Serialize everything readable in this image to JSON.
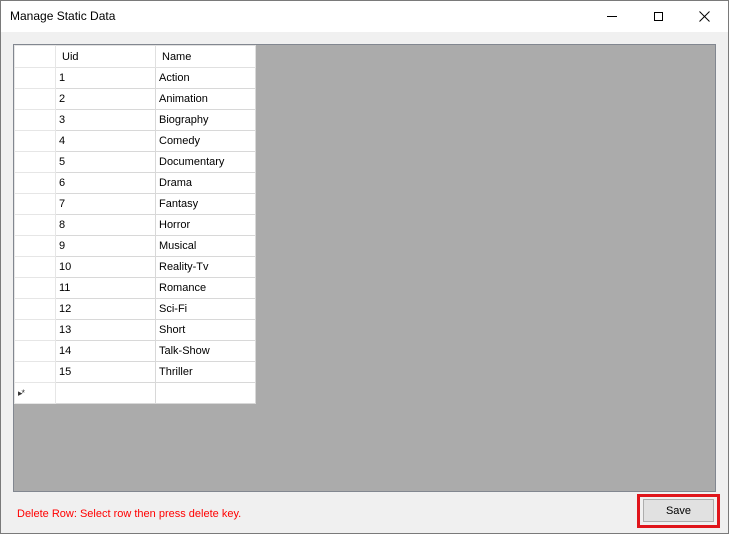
{
  "window": {
    "title": "Manage Static Data",
    "icons": {
      "minimize": "minimize-icon",
      "maximize": "maximize-icon",
      "close": "close-icon"
    }
  },
  "grid": {
    "columns": [
      "Uid",
      "Name"
    ],
    "rows": [
      {
        "uid": "1",
        "name": "Action"
      },
      {
        "uid": "2",
        "name": "Animation"
      },
      {
        "uid": "3",
        "name": "Biography"
      },
      {
        "uid": "4",
        "name": "Comedy"
      },
      {
        "uid": "5",
        "name": "Documentary"
      },
      {
        "uid": "6",
        "name": "Drama"
      },
      {
        "uid": "7",
        "name": "Fantasy"
      },
      {
        "uid": "8",
        "name": "Horror"
      },
      {
        "uid": "9",
        "name": "Musical"
      },
      {
        "uid": "10",
        "name": "Reality-Tv"
      },
      {
        "uid": "11",
        "name": "Romance"
      },
      {
        "uid": "12",
        "name": "Sci-Fi"
      },
      {
        "uid": "13",
        "name": "Short"
      },
      {
        "uid": "14",
        "name": "Talk-Show"
      },
      {
        "uid": "15",
        "name": "Thriller"
      }
    ],
    "new_row_marker": "▸*",
    "background_color": "#ababab"
  },
  "status": {
    "message": "Delete Row: Select row then press delete key.",
    "color": "#ff0000"
  },
  "actions": {
    "save_label": "Save",
    "highlight_color": "#e0151b"
  }
}
